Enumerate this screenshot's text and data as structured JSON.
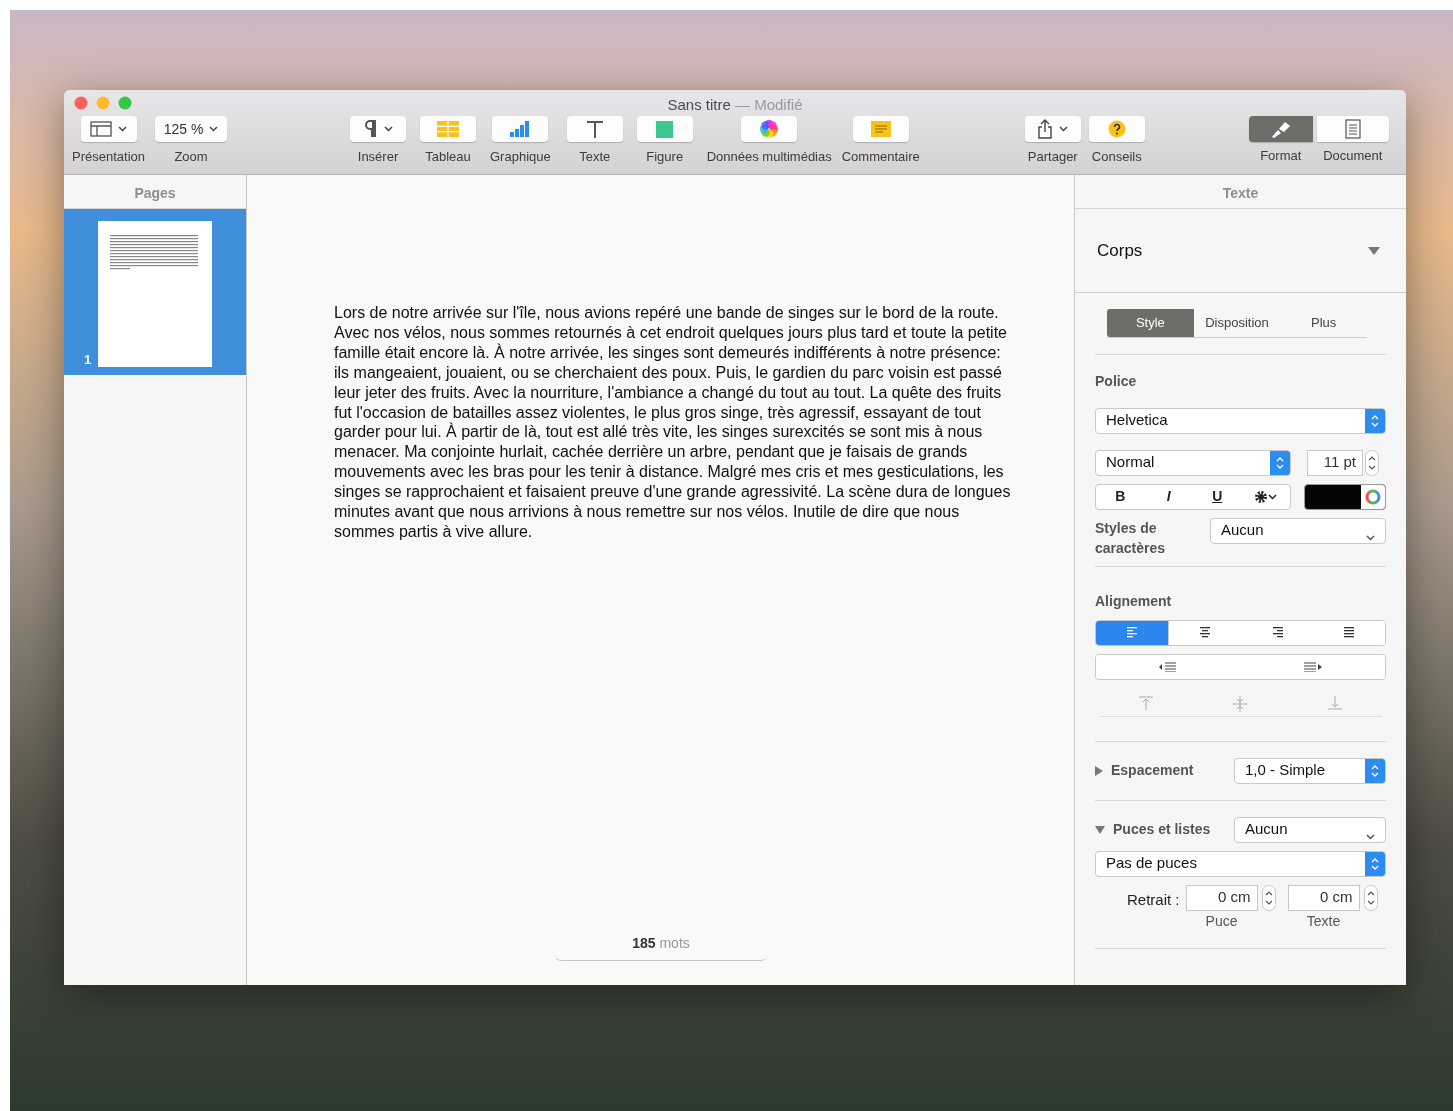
{
  "window": {
    "title": "Sans titre",
    "separator": "—",
    "status": "Modifié"
  },
  "toolbar": [
    {
      "label": "Présentation",
      "kind": "layout",
      "menu": true
    },
    {
      "label": "Zoom",
      "kind": "zoom",
      "value": "125 %",
      "menu": true
    },
    {
      "label": "Insérer",
      "kind": "pilcrow",
      "menu": true
    },
    {
      "label": "Tableau",
      "kind": "table",
      "menu": false
    },
    {
      "label": "Graphique",
      "kind": "chart",
      "menu": false
    },
    {
      "label": "Texte",
      "kind": "text",
      "menu": false
    },
    {
      "label": "Figure",
      "kind": "shape",
      "menu": false
    },
    {
      "label": "Données multimédias",
      "kind": "photos",
      "menu": false
    },
    {
      "label": "Commentaire",
      "kind": "comment",
      "menu": false
    },
    {
      "label": "Partager",
      "kind": "share",
      "menu": true
    },
    {
      "label": "Conseils",
      "kind": "help",
      "menu": false
    },
    {
      "label": "Format",
      "kind": "brush",
      "selected": true
    },
    {
      "label": "Document",
      "kind": "document",
      "selected": false
    }
  ],
  "sidebar": {
    "title": "Pages",
    "pages": [
      {
        "number": "1",
        "selected": true
      }
    ]
  },
  "document": {
    "lines": [
      "Lors de notre arrivée sur l'île, nous avions repéré une bande de singes sur le bord de la route.",
      "Avec nos vélos, nous sommes retournés à cet endroit quelques jours plus tard et toute la petite",
      "famille était encore là. À notre arrivée, les singes sont demeurés indifférents à notre présence:",
      "ils mangeaient, jouaient, ou se cherchaient des poux. Puis, le gardien du parc voisin est passé",
      "leur jeter des fruits. Avec la nourriture, l'ambiance a changé du tout au tout. La quête des fruits",
      "fut l'occasion de batailles assez violentes, le plus gros singe, très agressif, essayant de tout",
      "garder pour lui. À partir de là, tout est allé très vite, les singes surexcités se sont mis à nous",
      "menacer. Ma conjointe hurlait, cachée derrière un arbre, pendant que je faisais de grands",
      "mouvements avec les bras pour les tenir à distance. Malgré mes cris et mes gesticulations, les",
      "singes se rapprochaient et faisaient preuve d'une grande agressivité. La scène dura de longues",
      "minutes avant que nous arrivions à nous remettre sur nos vélos. Inutile de dire que nous",
      "sommes partis à vive allure."
    ],
    "word_count": "185",
    "word_unit": "mots"
  },
  "inspector": {
    "title": "Texte",
    "paragraph_style": "Corps",
    "tabs": [
      {
        "label": "Style",
        "selected": true
      },
      {
        "label": "Disposition",
        "selected": false
      },
      {
        "label": "Plus",
        "selected": false
      }
    ],
    "font_label": "Police",
    "font_family": "Helvetica",
    "typeface": "Normal",
    "size": "11 pt",
    "format_buttons": [
      {
        "label": "B",
        "kind": "bold"
      },
      {
        "label": "I",
        "kind": "italic"
      },
      {
        "label": "U",
        "kind": "underline"
      }
    ],
    "char_styles_label": "Styles de caractères",
    "char_style": "Aucun",
    "alignment_label": "Alignement",
    "alignment": [
      {
        "kind": "left",
        "selected": true
      },
      {
        "kind": "center",
        "selected": false
      },
      {
        "kind": "right",
        "selected": false
      },
      {
        "kind": "justify",
        "selected": false
      }
    ],
    "spacing": {
      "label": "Espacement",
      "expanded": false,
      "value": "1,0 - Simple"
    },
    "bullets": {
      "label": "Puces et listes",
      "expanded": true,
      "value": "Aucun",
      "type": "Pas de puces",
      "indent_label": "Retrait :",
      "bullet_indent": "0 cm",
      "bullet_caption": "Puce",
      "text_indent": "0 cm",
      "text_caption": "Texte"
    }
  }
}
